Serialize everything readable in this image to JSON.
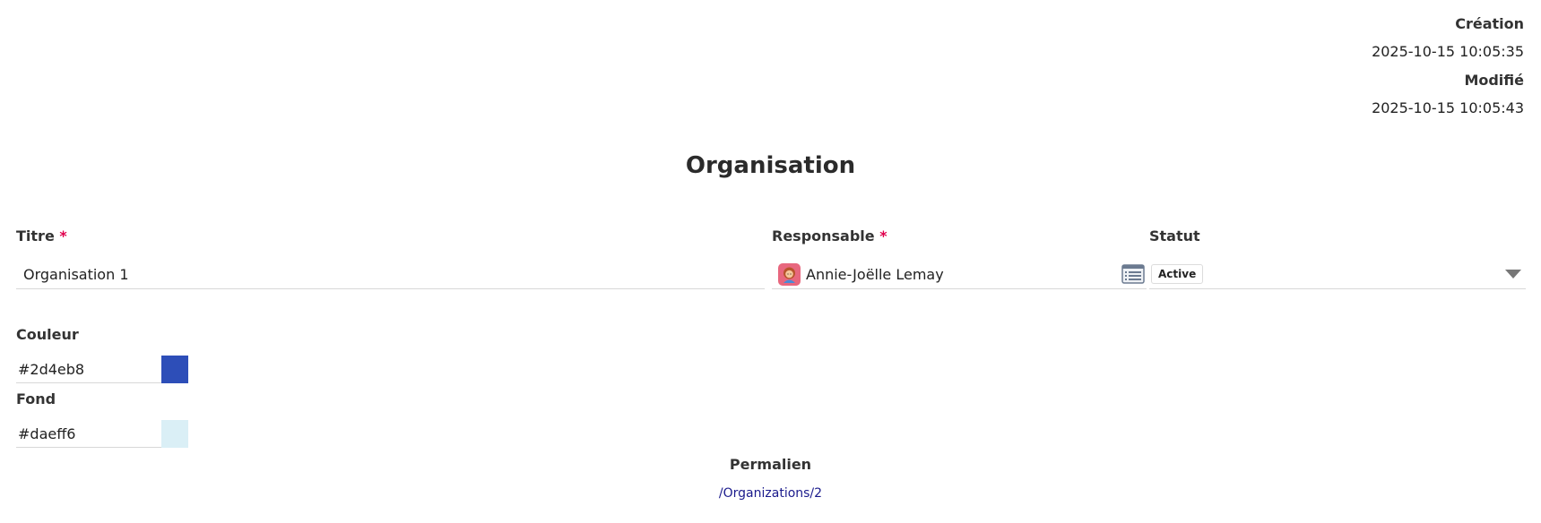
{
  "meta": {
    "created_label": "Création",
    "created_value": "2025-10-15 10:05:35",
    "modified_label": "Modifié",
    "modified_value": "2025-10-15 10:05:43"
  },
  "title": "Organisation",
  "fields": {
    "titre": {
      "label": "Titre",
      "required_mark": "*",
      "value": "Organisation 1"
    },
    "responsable": {
      "label": "Responsable",
      "required_mark": "*",
      "value": "Annie-Joëlle Lemay",
      "avatar_icon": "woman-avatar-icon",
      "picker_icon": "list-icon"
    },
    "statut": {
      "label": "Statut",
      "value": "Active",
      "dropdown_icon": "caret-down-icon"
    }
  },
  "couleur": {
    "label": "Couleur",
    "value": "#2d4eb8",
    "swatch_color": "#2d4eb8"
  },
  "fond": {
    "label": "Fond",
    "value": "#daeff6",
    "swatch_color": "#daeff6"
  },
  "permalink": {
    "label": "Permalien",
    "link": "/Organizations/2"
  }
}
